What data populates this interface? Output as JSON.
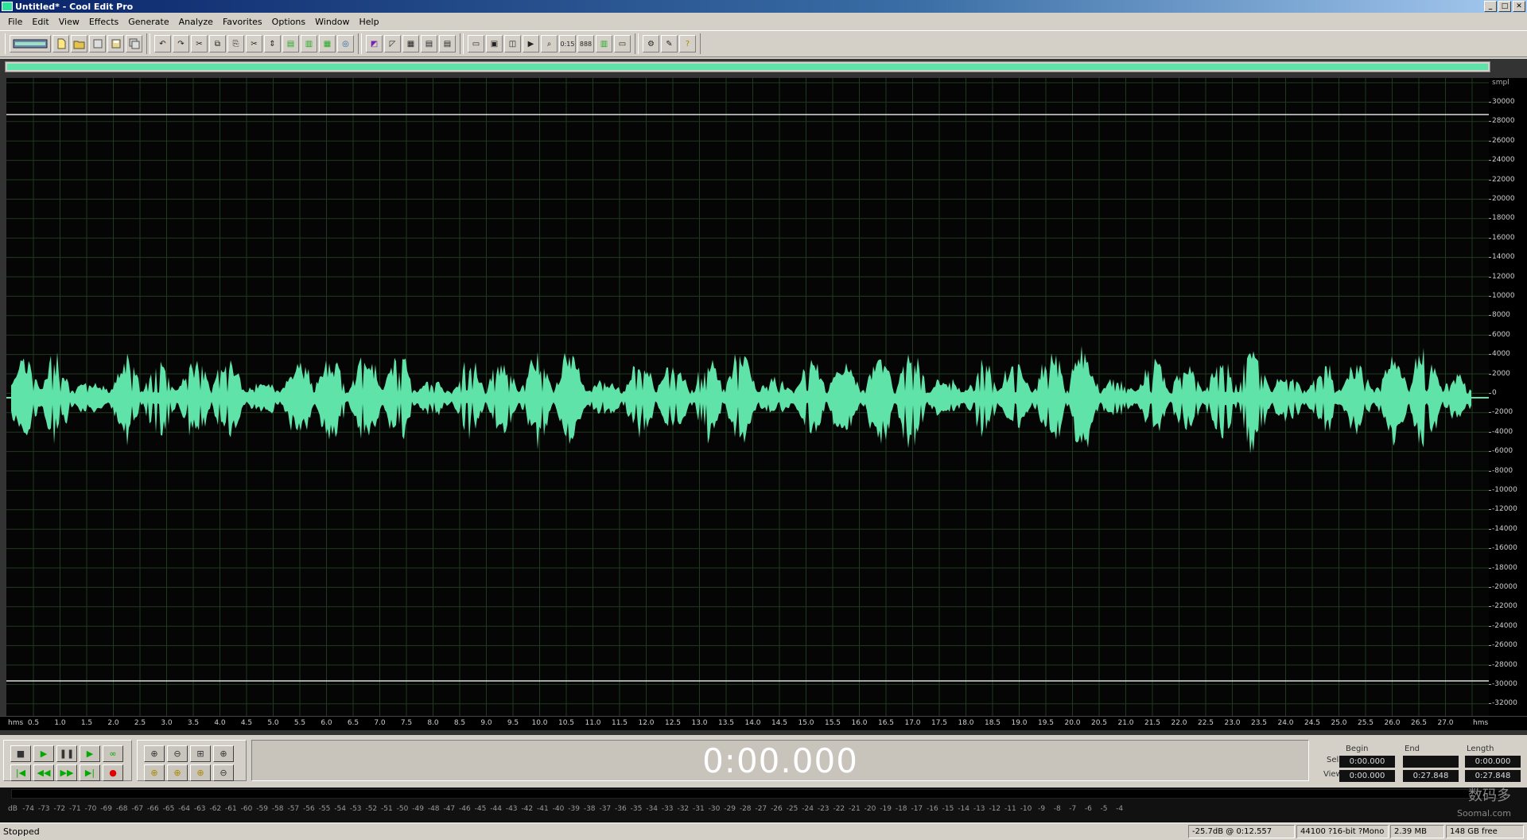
{
  "window": {
    "title": "Untitled* - Cool Edit Pro",
    "min": "_",
    "max": "□",
    "close": "✕"
  },
  "menu": [
    "File",
    "Edit",
    "View",
    "Effects",
    "Generate",
    "Analyze",
    "Favorites",
    "Options",
    "Window",
    "Help"
  ],
  "toolbar": {
    "groups": [
      [
        "mode-toggle",
        "new-file",
        "open-file",
        "close-file",
        "save-file",
        "save-all"
      ],
      [
        "undo",
        "redo",
        "repeat",
        "copy",
        "copy-new",
        "cut",
        "trim",
        "paste",
        "paste-new",
        "mix-paste",
        "cd-icon"
      ],
      [
        "envelope",
        "rect-select",
        "spectral",
        "bars",
        "bars2"
      ],
      [
        "cue-list",
        "play-list",
        "info",
        "play-mode",
        "zoom-tool",
        "time-fmt",
        "grid",
        "meters",
        "blank"
      ],
      [
        "settings",
        "scripts",
        "help"
      ]
    ],
    "labels": {
      "time_fmt": "0:15",
      "grid": "888"
    }
  },
  "waveform": {
    "color": "#5fe3a8",
    "overview_color": "#5fe3a8",
    "vertical_unit": "smpl",
    "vertical_labels": [
      "30000",
      "28000",
      "26000",
      "24000",
      "22000",
      "20000",
      "18000",
      "16000",
      "14000",
      "12000",
      "10000",
      "8000",
      "6000",
      "4000",
      "2000",
      "0",
      "-2000",
      "-4000",
      "-6000",
      "-8000",
      "-10000",
      "-12000",
      "-14000",
      "-16000",
      "-18000",
      "-20000",
      "-22000",
      "-24000",
      "-26000",
      "-28000",
      "-30000",
      "-32000"
    ],
    "horizontal_unit_left": "hms",
    "horizontal_unit_right": "hms",
    "horizontal_labels": [
      "0.5",
      "1.0",
      "1.5",
      "2.0",
      "2.5",
      "3.0",
      "3.5",
      "4.0",
      "4.5",
      "5.0",
      "5.5",
      "6.0",
      "6.5",
      "7.0",
      "7.5",
      "8.0",
      "8.5",
      "9.0",
      "9.5",
      "10.0",
      "10.5",
      "11.0",
      "11.5",
      "12.0",
      "12.5",
      "13.0",
      "13.5",
      "14.0",
      "14.5",
      "15.0",
      "15.5",
      "16.0",
      "16.5",
      "17.0",
      "17.5",
      "18.0",
      "18.5",
      "19.0",
      "19.5",
      "20.0",
      "20.5",
      "21.0",
      "21.5",
      "22.0",
      "22.5",
      "23.0",
      "23.5",
      "24.0",
      "24.5",
      "25.0",
      "25.5",
      "26.0",
      "26.5",
      "27.0"
    ]
  },
  "transport": {
    "buttons": [
      "■",
      "▶",
      "❚❚",
      "▶",
      "∞",
      "|◀",
      "◀◀",
      "▶▶",
      "▶|",
      "●"
    ],
    "zoom": [
      "⊕",
      "⊖",
      "⊞",
      "⊕",
      "⊕",
      "⊕",
      "⊕",
      "⊖"
    ],
    "time": "0:00.000"
  },
  "selection": {
    "headers": {
      "begin": "Begin",
      "end": "End",
      "length": "Length"
    },
    "sel_label": "Sel",
    "view_label": "View",
    "sel_begin": "0:00.000",
    "sel_end": "",
    "sel_length": "0:00.000",
    "view_begin": "0:00.000",
    "view_end": "0:27.848",
    "view_length": "0:27.848"
  },
  "level_meter": {
    "labels": [
      "dB",
      "-74",
      "-73",
      "-72",
      "-71",
      "-70",
      "-69",
      "-68",
      "-67",
      "-66",
      "-65",
      "-64",
      "-63",
      "-62",
      "-61",
      "-60",
      "-59",
      "-58",
      "-57",
      "-56",
      "-55",
      "-54",
      "-53",
      "-52",
      "-51",
      "-50",
      "-49",
      "-48",
      "-47",
      "-46",
      "-45",
      "-44",
      "-43",
      "-42",
      "-41",
      "-40",
      "-39",
      "-38",
      "-37",
      "-36",
      "-35",
      "-34",
      "-33",
      "-32",
      "-31",
      "-30",
      "-29",
      "-28",
      "-27",
      "-26",
      "-25",
      "-24",
      "-23",
      "-22",
      "-21",
      "-20",
      "-19",
      "-18",
      "-17",
      "-16",
      "-15",
      "-14",
      "-13",
      "-12",
      "-11",
      "-10",
      "-9",
      "-8",
      "-7",
      "-6",
      "-5",
      "-4"
    ]
  },
  "status": {
    "state": "Stopped",
    "cursor": "-25.7dB @   0:12.557",
    "format": "44100 ?16-bit ?Mono",
    "size": "2.39 MB",
    "free": "148 GB free"
  },
  "watermark": {
    "cn": "数码多",
    "url": "Soomal.com"
  }
}
